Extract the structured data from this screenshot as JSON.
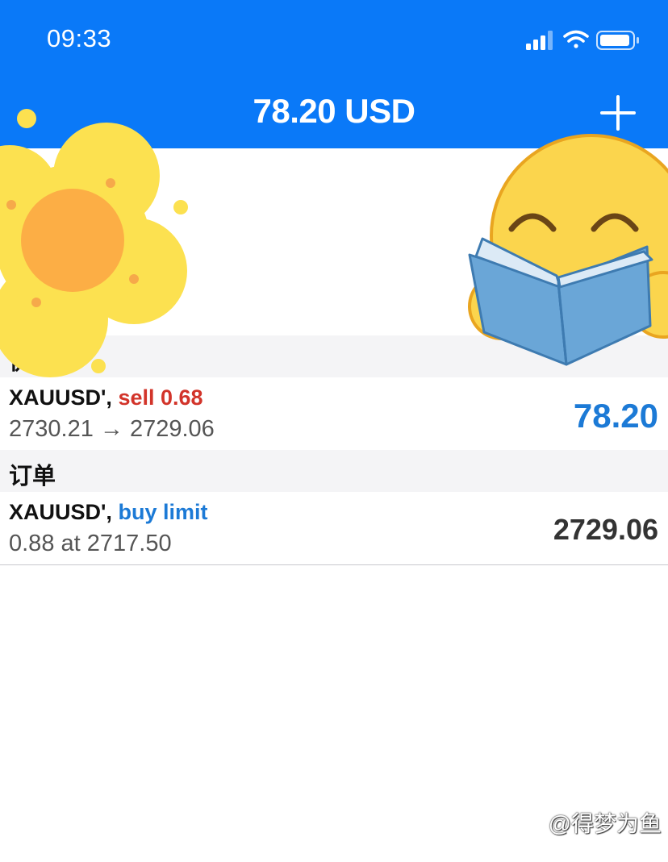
{
  "status_bar": {
    "time": "09:33",
    "icons": [
      "signal-icon",
      "wifi-icon",
      "battery-icon"
    ]
  },
  "nav": {
    "title": "78.20 USD",
    "add_icon": "plus-icon"
  },
  "summary_fragment": "(%)",
  "positions": {
    "section_title": "价位",
    "items": [
      {
        "symbol": "XAUUSD',",
        "side": "sell 0.68",
        "prices": "2730.21 → 2729.06",
        "profit": "78.20"
      }
    ]
  },
  "orders": {
    "section_title": "订单",
    "items": [
      {
        "symbol": "XAUUSD',",
        "type": "buy limit",
        "details": "0.88 at 2717.50",
        "price": "2729.06"
      }
    ]
  },
  "watermark": "@得梦为鱼",
  "colors": {
    "header_bg": "#0a79f8",
    "sell": "#d2342a",
    "buy": "#1c7ad6",
    "profit": "#1c7ad6",
    "price": "#333333"
  }
}
